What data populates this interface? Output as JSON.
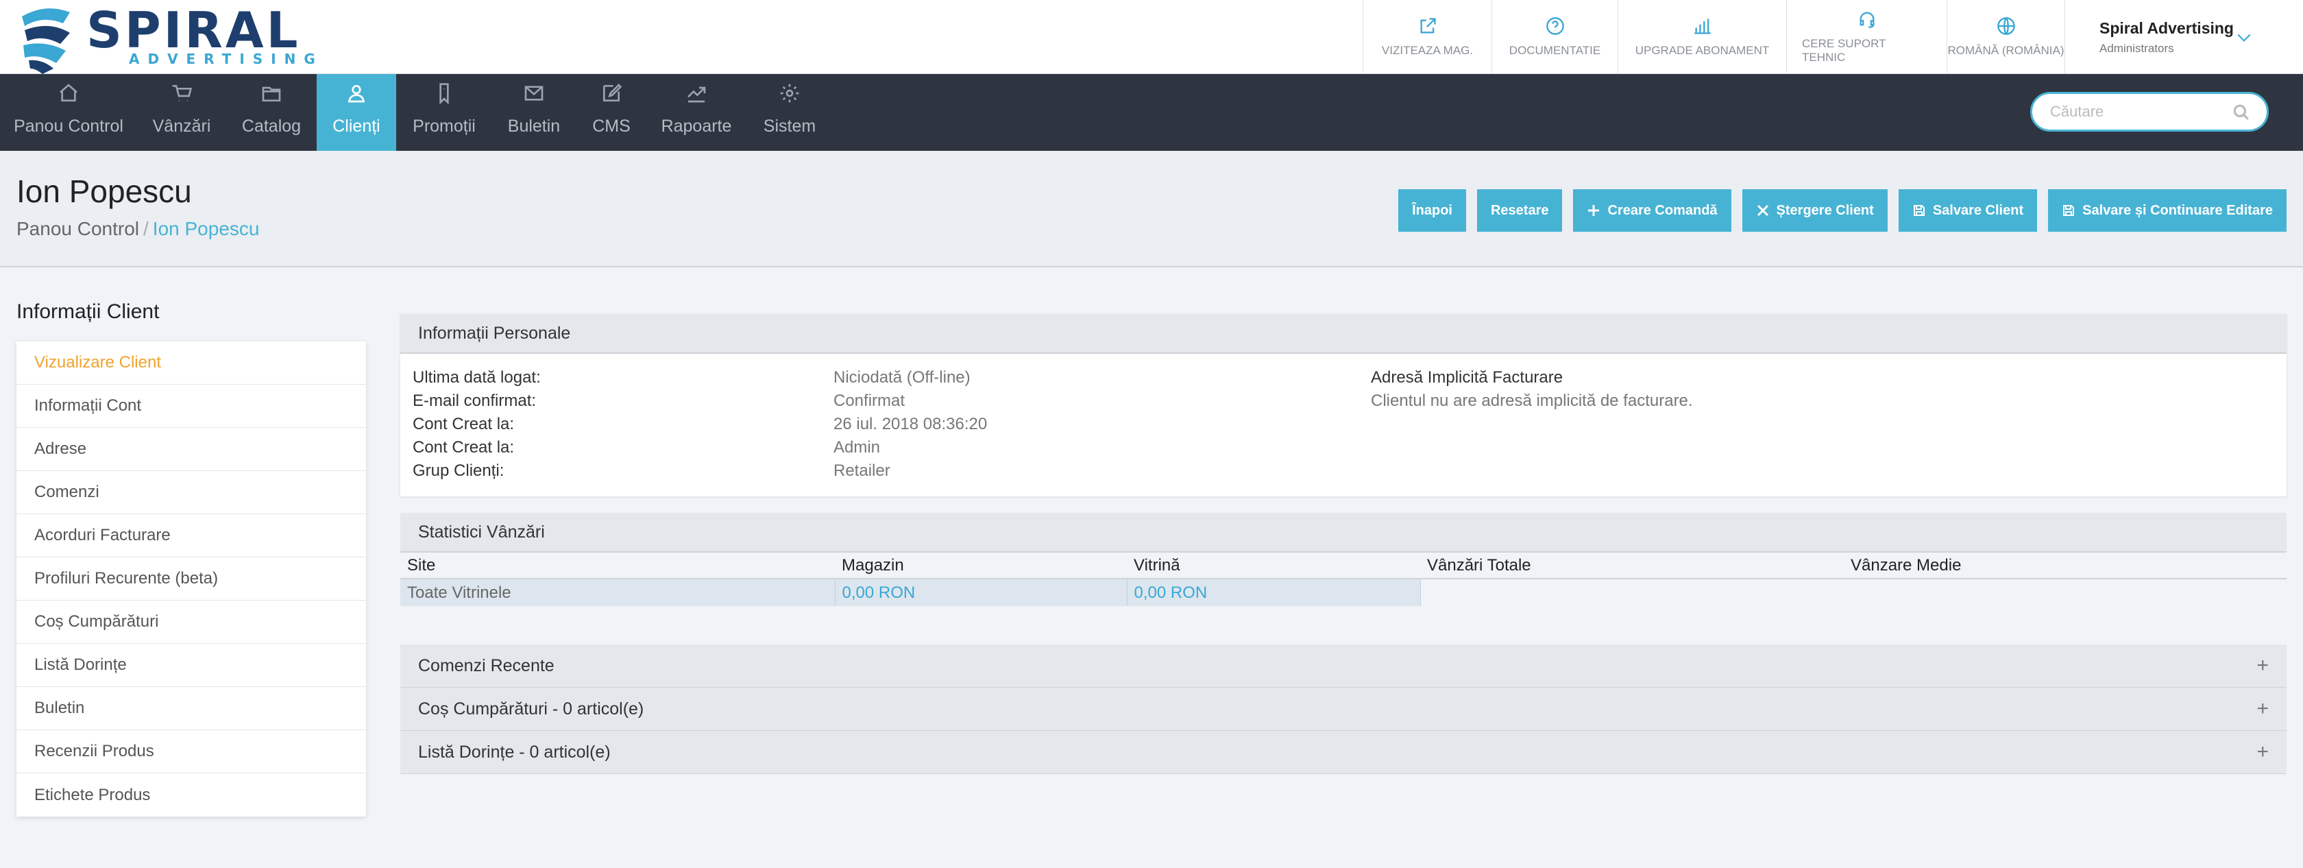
{
  "brand": {
    "name": "SPIRAL",
    "sub": "ADVERTISING",
    "colors": {
      "dark": "#1e3f6e",
      "accent": "#3aa7d4"
    }
  },
  "top_links": [
    {
      "label": "VIZITEAZA MAG.",
      "icon": "external-link-icon"
    },
    {
      "label": "DOCUMENTATIE",
      "icon": "help-circle-icon"
    },
    {
      "label": "UPGRADE ABONAMENT",
      "icon": "bar-chart-icon"
    },
    {
      "label": "CERE SUPORT TEHNIC",
      "icon": "headset-icon"
    },
    {
      "label": "ROMÂNĂ (ROMÂNIA)",
      "icon": "globe-icon"
    }
  ],
  "user": {
    "name": "Spiral Advertising",
    "role": "Administrators"
  },
  "nav": [
    {
      "label": "Panou Control",
      "icon": "home-icon"
    },
    {
      "label": "Vânzări",
      "icon": "cart-icon"
    },
    {
      "label": "Catalog",
      "icon": "folder-icon"
    },
    {
      "label": "Clienți",
      "icon": "user-icon",
      "active": true
    },
    {
      "label": "Promoții",
      "icon": "tag-icon"
    },
    {
      "label": "Buletin",
      "icon": "mail-icon"
    },
    {
      "label": "CMS",
      "icon": "edit-icon"
    },
    {
      "label": "Rapoarte",
      "icon": "line-chart-icon"
    },
    {
      "label": "Sistem",
      "icon": "gear-icon"
    }
  ],
  "search": {
    "placeholder": "Căutare",
    "value": ""
  },
  "page": {
    "title": "Ion Popescu",
    "breadcrumb": {
      "root": "Panou Control",
      "sep": "/",
      "current": "Ion Popescu"
    }
  },
  "actions": {
    "back": "Înapoi",
    "reset": "Resetare",
    "create_order": "Creare Comandă",
    "delete": "Ștergere Client",
    "save": "Salvare Client",
    "save_continue": "Salvare și Continuare Editare"
  },
  "sidebar": {
    "title": "Informații Client",
    "items": [
      "Vizualizare Client",
      "Informații Cont",
      "Adrese",
      "Comenzi",
      "Acorduri Facturare",
      "Profiluri Recurente (beta)",
      "Coș Cumpărături",
      "Listă Dorințe",
      "Buletin",
      "Recenzii Produs",
      "Etichete Produs"
    ],
    "active_color": "#f0a32e"
  },
  "personal": {
    "title": "Informații Personale",
    "rows": [
      {
        "label": "Ultima dată logat:",
        "value": "Niciodată (Off-line)"
      },
      {
        "label": "E-mail confirmat:",
        "value": "Confirmat"
      },
      {
        "label": "Cont Creat la:",
        "value": "26 iul. 2018 08:36:20"
      },
      {
        "label": "Cont Creat la:",
        "value": "Admin"
      },
      {
        "label": "Grup Clienți:",
        "value": "Retailer"
      }
    ],
    "billing_title": "Adresă Implicită Facturare",
    "billing_text": "Clientul nu are adresă implicită de facturare."
  },
  "stats": {
    "title": "Statistici Vânzări",
    "headers": [
      "Site",
      "Magazin",
      "Vitrină",
      "Vânzări Totale",
      "Vânzare Medie"
    ],
    "row": {
      "site": "Toate Vitrinele",
      "store": "0,00 RON",
      "view": "0,00 RON"
    }
  },
  "accordion": [
    {
      "label": "Comenzi Recente",
      "toggle": "+"
    },
    {
      "label": "Coș Cumpărături - 0 articol(e)",
      "toggle": "+"
    },
    {
      "label": "Listă Dorințe - 0 articol(e)",
      "toggle": "+"
    }
  ]
}
